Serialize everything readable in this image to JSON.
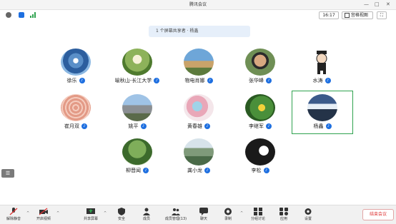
{
  "window": {
    "title": "腾讯会议"
  },
  "window_controls": {
    "minimize": "—",
    "maximize": "□",
    "close": "✕"
  },
  "status": {
    "time": "16:17",
    "layout_label": "宫格视图",
    "full_label": "⛶"
  },
  "banner": {
    "text": "1 个屏幕共享者 · 杨鑫"
  },
  "participants": [
    {
      "name": "徐乐"
    },
    {
      "name": "喻秋山-长江大学"
    },
    {
      "name": "物电肖娜"
    },
    {
      "name": "张华峰"
    },
    {
      "name": "水涛"
    },
    {
      "name": "崔月双"
    },
    {
      "name": "姚平"
    },
    {
      "name": "黄春雄"
    },
    {
      "name": "李继军"
    },
    {
      "name": "杨鑫"
    },
    {
      "name": "柳晋闻"
    },
    {
      "name": "龚小龙"
    },
    {
      "name": "李松"
    }
  ],
  "toolbar": {
    "mute_label": "解除静音",
    "video_label": "开启视频",
    "share_label": "共享屏幕",
    "security_label": "安全",
    "members_label": "成员",
    "manage_label": "成员管理(13)",
    "chat_label": "聊天",
    "record_label": "录制",
    "rooms_label": "分组讨论",
    "apps_label": "应用",
    "settings_label": "设置",
    "end_label": "结束会议"
  },
  "colors": {
    "accent": "#1e6fe0",
    "active_border": "#2fa24f",
    "end": "#d33333"
  }
}
